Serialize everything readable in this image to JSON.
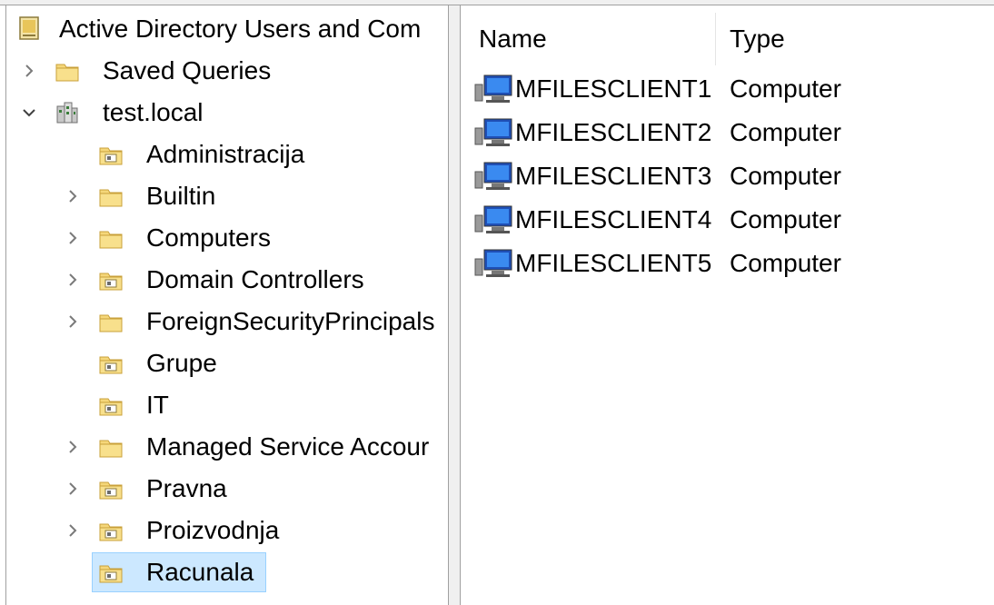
{
  "tree": {
    "root_label": "Active Directory Users and Com",
    "items": [
      {
        "label": "Saved Queries",
        "icon": "folder-icon",
        "expand": "collapsed"
      },
      {
        "label": "test.local",
        "icon": "domain-icon",
        "expand": "expanded"
      },
      {
        "label": "Administracija",
        "icon": "ou-folder-icon",
        "expand": "none"
      },
      {
        "label": "Builtin",
        "icon": "folder-icon",
        "expand": "collapsed"
      },
      {
        "label": "Computers",
        "icon": "folder-icon",
        "expand": "collapsed"
      },
      {
        "label": "Domain Controllers",
        "icon": "ou-folder-icon",
        "expand": "collapsed"
      },
      {
        "label": "ForeignSecurityPrincipals",
        "icon": "folder-icon",
        "expand": "collapsed"
      },
      {
        "label": "Grupe",
        "icon": "ou-folder-icon",
        "expand": "none"
      },
      {
        "label": "IT",
        "icon": "ou-folder-icon",
        "expand": "none"
      },
      {
        "label": "Managed Service Accour",
        "icon": "folder-icon",
        "expand": "collapsed"
      },
      {
        "label": "Pravna",
        "icon": "ou-folder-icon",
        "expand": "collapsed"
      },
      {
        "label": "Proizvodnja",
        "icon": "ou-folder-icon",
        "expand": "collapsed"
      },
      {
        "label": "Racunala",
        "icon": "ou-folder-icon",
        "expand": "none",
        "selected": true
      }
    ]
  },
  "list": {
    "columns": [
      "Name",
      "Type"
    ],
    "rows": [
      {
        "name": "MFILESCLIENT1",
        "type": "Computer"
      },
      {
        "name": "MFILESCLIENT2",
        "type": "Computer"
      },
      {
        "name": "MFILESCLIENT3",
        "type": "Computer"
      },
      {
        "name": "MFILESCLIENT4",
        "type": "Computer"
      },
      {
        "name": "MFILESCLIENT5",
        "type": "Computer"
      }
    ]
  },
  "colors": {
    "selection": "#cce8ff",
    "folder": "#f5d77a",
    "folder_dark": "#d9a934"
  }
}
